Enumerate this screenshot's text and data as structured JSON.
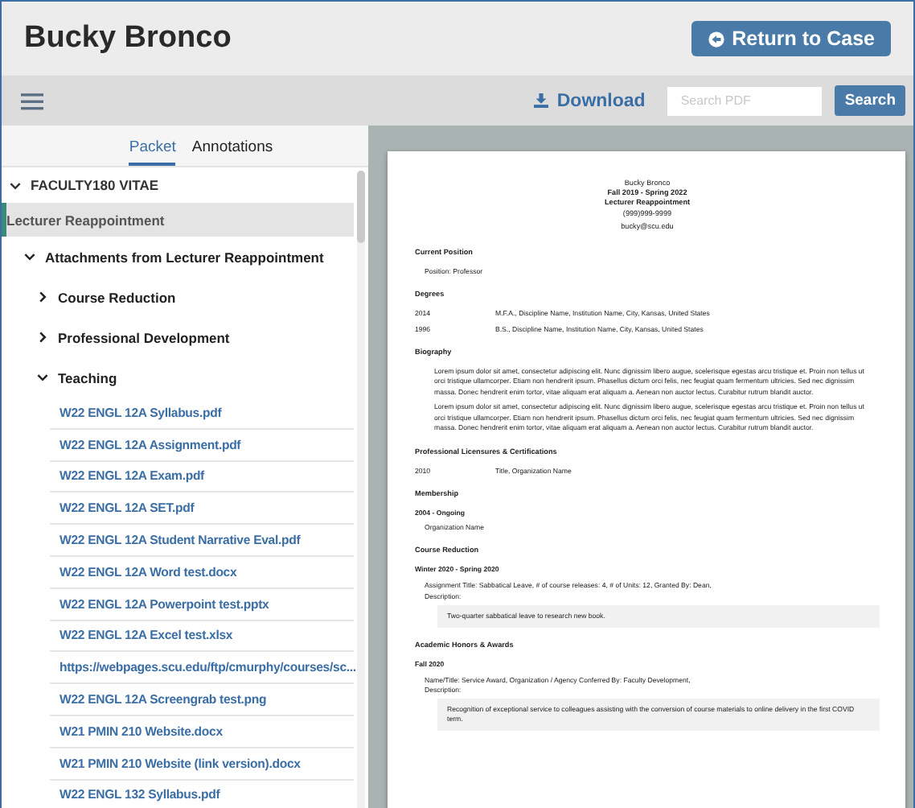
{
  "header": {
    "title": "Bucky Bronco",
    "return_button": "Return to Case"
  },
  "toolbar": {
    "download": "Download",
    "search": {
      "placeholder": "Search PDF"
    },
    "search_button": "Search"
  },
  "tabs": [
    {
      "label": "Packet",
      "selected": true
    },
    {
      "label": "Annotations",
      "selected": false
    }
  ],
  "tree": {
    "label": "FACULTY180 VITAE",
    "expanded": true,
    "selected": false,
    "children": [
      {
        "label": "Lecturer Reappointment",
        "selected": true
      },
      {
        "label": "Attachments from Lecturer Reappointment",
        "expanded": true,
        "selected": false,
        "children": [
          {
            "label": "Course Reduction",
            "expanded": false,
            "selected": false
          },
          {
            "label": "Professional Development",
            "expanded": false,
            "selected": false
          },
          {
            "label": "Teaching",
            "expanded": true,
            "selected": false,
            "children": [
              {
                "label": "W22 ENGL 12A Syllabus.pdf",
                "selected": false
              },
              {
                "label": "W22 ENGL 12A Assignment.pdf",
                "selected": false
              },
              {
                "label": "W22 ENGL 12A Exam.pdf",
                "selected": false
              },
              {
                "label": "W22 ENGL 12A SET.pdf",
                "selected": false
              },
              {
                "label": "W22 ENGL 12A Student Narrative Eval.pdf",
                "selected": false
              },
              {
                "label": "W22 ENGL 12A Word test.docx",
                "selected": false
              },
              {
                "label": "W22 ENGL 12A Powerpoint test.pptx",
                "selected": false
              },
              {
                "label": "W22 ENGL 12A Excel test.xlsx",
                "selected": false
              },
              {
                "label": "https://webpages.scu.edu/ftp/cmurphy/courses/sc...",
                "selected": false
              },
              {
                "label": "W22 ENGL 12A Screengrab test.png",
                "selected": false
              },
              {
                "label": "W21 PMIN 210 Website.docx",
                "selected": false
              },
              {
                "label": "W21 PMIN 210 Website (link version).docx",
                "selected": false
              },
              {
                "label": "W22 ENGL 132 Syllabus.pdf",
                "selected": false
              }
            ]
          }
        ]
      }
    ]
  },
  "document": {
    "heading": [
      "Bucky Bronco",
      "Fall 2019 - Spring 2022",
      "Lecturer Reappointment",
      "(999)999-9999",
      "bucky@scu.edu"
    ],
    "sections": [
      {
        "title": "Current Position",
        "entries": [
          {
            "kind": "line",
            "text": "Position: Professor"
          }
        ]
      },
      {
        "title": "Degrees",
        "entries": [
          {
            "kind": "row",
            "year": "2014",
            "text": "M.F.A., Discipline Name, Institution Name, City, Kansas, United States"
          },
          {
            "kind": "row",
            "year": "1996",
            "text": "B.S., Discipline Name, Institution Name, City, Kansas, United States"
          }
        ]
      },
      {
        "title": "Biography",
        "entries": [
          {
            "kind": "para",
            "text": "Lorem ipsum dolor sit amet, consectetur adipiscing elit. Nunc dignissim libero augue, scelerisque egestas arcu tristique et. Proin non tellus ut orci tristique ullamcorper. Etiam non hendrerit ipsum. Phasellus dictum orci felis, nec feugiat quam fermentum ultricies. Sed nec dignissim massa. Donec hendrerit enim tortor, vitae aliquam erat aliquam a. Aenean non auctor lectus. Curabitur rutrum blandit auctor."
          },
          {
            "kind": "para",
            "text": "Lorem ipsum dolor sit amet, consectetur adipiscing elit. Nunc dignissim libero augue, scelerisque egestas arcu tristique et. Proin non tellus ut orci tristique ullamcorper. Etiam non hendrerit ipsum. Phasellus dictum orci felis, nec feugiat quam fermentum ultricies. Sed nec dignissim massa. Donec hendrerit enim tortor, vitae aliquam erat aliquam a. Aenean non auctor lectus. Curabitur rutrum blandit auctor."
          }
        ]
      },
      {
        "title": "Professional Licensures & Certifications",
        "entries": [
          {
            "kind": "row",
            "year": "2010",
            "text": "Title, Organization Name"
          }
        ]
      },
      {
        "title": "Membership",
        "entries": [
          {
            "kind": "date",
            "text": "2004 - Ongoing"
          },
          {
            "kind": "line",
            "text": "Organization Name"
          }
        ]
      },
      {
        "title": "Course Reduction",
        "entries": [
          {
            "kind": "date",
            "text": "Winter 2020 - Spring 2020"
          },
          {
            "kind": "line",
            "text": "Assignment Title: Sabbatical Leave, # of course releases: 4, # of Units: 12, Granted By: Dean,"
          },
          {
            "kind": "line",
            "text": "Description:"
          },
          {
            "kind": "box",
            "text": "Two-quarter sabbatical leave to research new book."
          }
        ]
      },
      {
        "title": "Academic Honors & Awards",
        "entries": [
          {
            "kind": "date",
            "text": "Fall 2020"
          },
          {
            "kind": "line",
            "text": "Name/Title: Service Award, Organization / Agency Conferred By: Faculty Development,"
          },
          {
            "kind": "line",
            "text": "Description:"
          },
          {
            "kind": "box",
            "text": "Recognition of exceptional service to colleagues assisting with the conversion of course materials to online delivery in the first COVID term."
          }
        ]
      }
    ]
  }
}
